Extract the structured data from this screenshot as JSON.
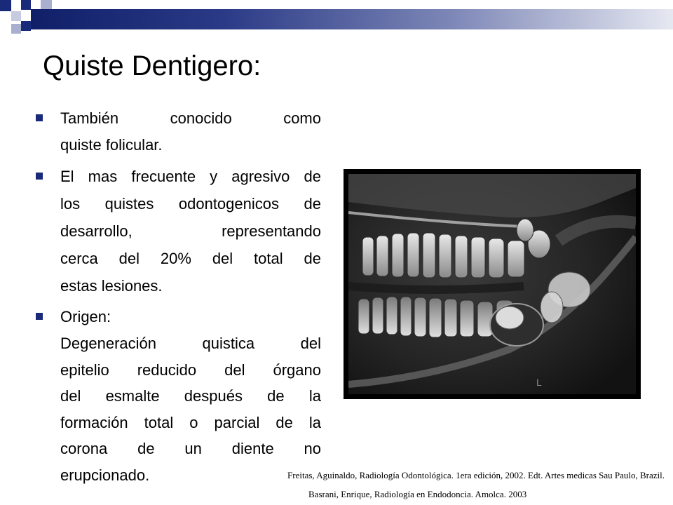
{
  "slide": {
    "title": "Quiste Dentigero:",
    "bullets": [
      {
        "lines": [
          "También conocido como",
          "quiste folicular."
        ]
      },
      {
        "lines": [
          "El mas frecuente y agresivo de",
          "los quistes odontogenicos de",
          "desarrollo, representando",
          "cerca del 20% del total de",
          "estas lesiones."
        ]
      },
      {
        "lines": [
          "Origen:"
        ]
      }
    ],
    "paragraph": {
      "lines": [
        "Degeneración quistica del",
        "epitelio reducido del órgano",
        "del esmalte después de la",
        "formación total o parcial de la",
        "corona de un diente no",
        "erupcionado."
      ]
    },
    "image": {
      "subject": "panoramic-dental-radiograph"
    },
    "references": [
      "Freitas, Aguinaldo, Radiología Odontológica. 1era edición, 2002. Edt. Artes medicas Sau Paulo, Brazil.",
      "Basrani, Enrique, Radiología en Endodoncia. Amolca. 2003"
    ]
  },
  "colors": {
    "accent": "#1a2a7a",
    "header_dark": "#101f68",
    "header_light": "#e6e8f1"
  }
}
